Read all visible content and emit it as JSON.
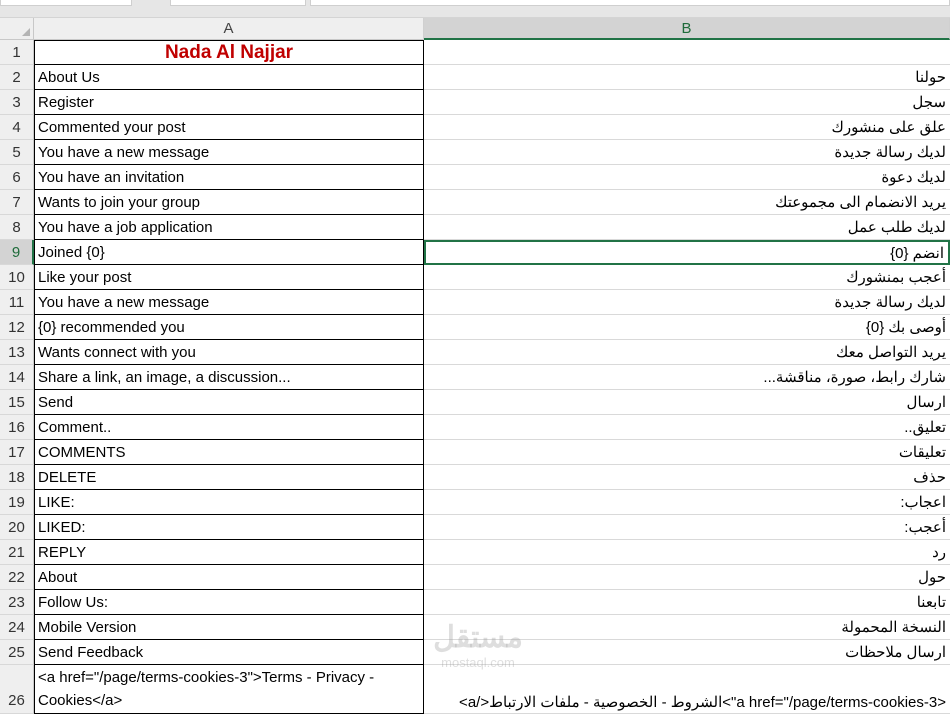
{
  "columns": {
    "a": "A",
    "b": "B"
  },
  "title": "Nada Al Najjar",
  "rows": [
    {
      "num": "1"
    },
    {
      "num": "2",
      "a": "About Us",
      "b": "حولنا"
    },
    {
      "num": "3",
      "a": "Register",
      "b": "سجل"
    },
    {
      "num": "4",
      "a": "Commented your post",
      "b": "علق على منشورك"
    },
    {
      "num": "5",
      "a": "You have a new message",
      "b": "لديك رسالة جديدة"
    },
    {
      "num": "6",
      "a": "You have an invitation",
      "b": "لديك دعوة"
    },
    {
      "num": "7",
      "a": "Wants to join your group",
      "b": "يريد الانضمام الى مجموعتك"
    },
    {
      "num": "8",
      "a": "You have a job application",
      "b": "لديك طلب عمل"
    },
    {
      "num": "9",
      "a": "Joined {0}",
      "b": "انضم {0}"
    },
    {
      "num": "10",
      "a": "Like your post",
      "b": "أعجب بمنشورك"
    },
    {
      "num": "11",
      "a": "You have a new message",
      "b": "لديك رسالة جديدة"
    },
    {
      "num": "12",
      "a": "{0} recommended you",
      "b": "أوصى بك {0}"
    },
    {
      "num": "13",
      "a": "Wants connect with you",
      "b": "يريد التواصل معك"
    },
    {
      "num": "14",
      "a": "Share a link, an image, a discussion...",
      "b": "شارك رابط، صورة، مناقشة..."
    },
    {
      "num": "15",
      "a": "Send",
      "b": "ارسال"
    },
    {
      "num": "16",
      "a": "Comment..",
      "b": "تعليق.."
    },
    {
      "num": "17",
      "a": "COMMENTS",
      "b": "تعليقات"
    },
    {
      "num": "18",
      "a": "DELETE",
      "b": "حذف"
    },
    {
      "num": "19",
      "a": "LIKE:",
      "b": "اعجاب:"
    },
    {
      "num": "20",
      "a": "LIKED:",
      "b": "أعجب:"
    },
    {
      "num": "21",
      "a": "REPLY",
      "b": "رد"
    },
    {
      "num": "22",
      "a": "About",
      "b": "حول"
    },
    {
      "num": "23",
      "a": "Follow Us:",
      "b": "تابعنا"
    },
    {
      "num": "24",
      "a": "Mobile Version",
      "b": "النسخة المحمولة"
    },
    {
      "num": "25",
      "a": "Send Feedback",
      "b": "ارسال ملاحظات"
    },
    {
      "num": "26",
      "a": "<a href=\"/page/terms-cookies-3\">Terms - Privacy - Cookies</a>",
      "b": "<a href=\"/page/terms-cookies-3\">الشروط - الخصوصية - ملفات الارتباط</a>"
    }
  ],
  "watermark": {
    "line1": "مستقل",
    "line2": "mostaql.com"
  },
  "colors": {
    "title": "#c00000",
    "selection": "#217346"
  }
}
